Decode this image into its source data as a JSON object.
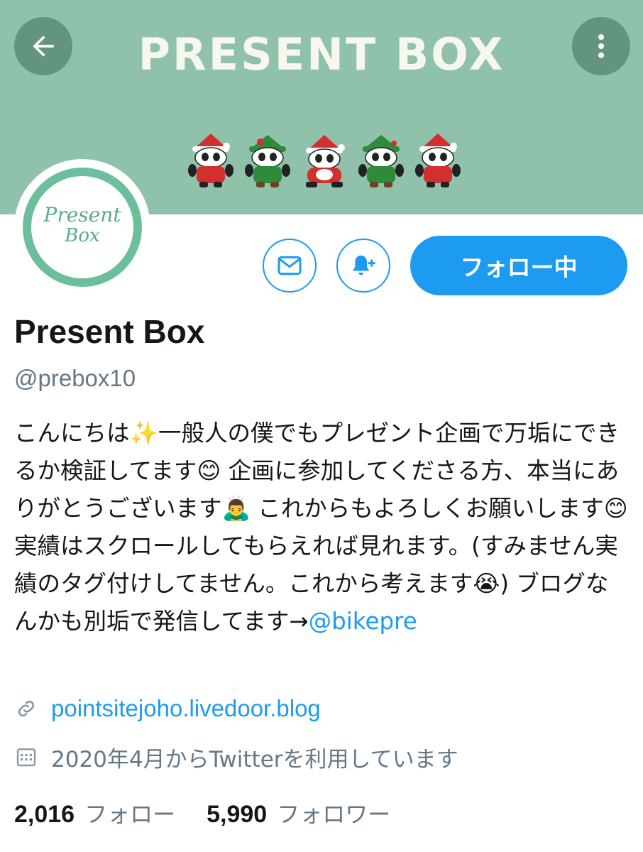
{
  "header": {
    "banner_title": "PRESENT BOX",
    "back_icon": "arrow-left-icon",
    "more_icon": "more-vertical-icon",
    "banner_color": "#8fc1ab"
  },
  "avatar": {
    "line1": "Present",
    "line2": "Box",
    "ring_color": "#6cbf9c"
  },
  "actions": {
    "message_icon": "mail-icon",
    "notify_icon": "bell-plus-icon",
    "follow_label": "フォロー中",
    "accent_color": "#1d9bf0"
  },
  "profile": {
    "name": "Present Box",
    "handle": "@prebox10",
    "bio_text": "こんにちは✨一般人の僕でもプレゼント企画で万垢にできるか検証してます😊 企画に参加してくださる方、本当にありがとうございます🙇‍♂️ これからもよろしくお願いします😊 実績はスクロールしてもらえれば見れます。(すみません実績のタグ付けしてません。これから考えます😭) ブログなんかも別垢で発信してます→",
    "bio_mention": "@bikepre",
    "link": "pointsitejoho.livedoor.blog",
    "joined": "2020年4月からTwitterを利用しています"
  },
  "stats": {
    "following_count": "2,016",
    "following_label": "フォロー",
    "followers_count": "5,990",
    "followers_label": "フォロワー"
  }
}
